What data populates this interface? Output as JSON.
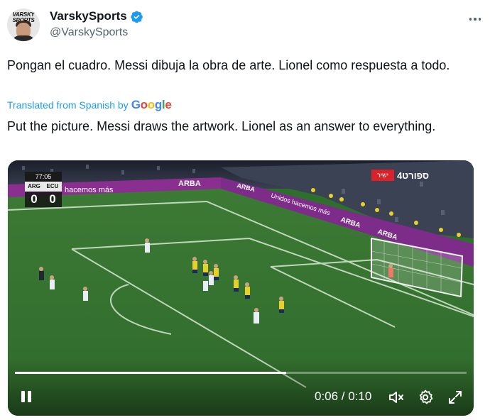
{
  "tweet": {
    "display_name": "VarskySports",
    "handle": "@VarskySports",
    "avatar_text": "VARSKY SPORTS",
    "verified": true,
    "text": "Pongan el cuadro. Messi dibuja la obra de arte. Lionel como respuesta a todo.",
    "translated_label": "Translated from Spanish by",
    "translation_provider": "Google",
    "translation": "Put the picture. Messi draws the artwork. Lionel as an answer to everything."
  },
  "video": {
    "scoreboard": {
      "clock": "77:05",
      "home": "ARG",
      "away": "ECU",
      "home_goals": "0",
      "away_goals": "0"
    },
    "channel": {
      "label_he": "ישיר",
      "logo": "4ספורט"
    },
    "ad_boards": [
      "hacemos más",
      "ARBA",
      "ARBA",
      "Unidos hacemos más",
      "ARBA",
      "ARBA"
    ],
    "time_current": "0:06",
    "time_total": "0:10",
    "time_display": "0:06 / 0:10",
    "progress_fraction": 0.6,
    "icons": [
      "pause-icon",
      "volume-muted-icon",
      "settings-icon",
      "fullscreen-icon"
    ]
  },
  "colors": {
    "verified": "#1d9bf0",
    "link": "#1d9bf0",
    "handle": "#536471",
    "pitch": "#2e6f2e"
  }
}
